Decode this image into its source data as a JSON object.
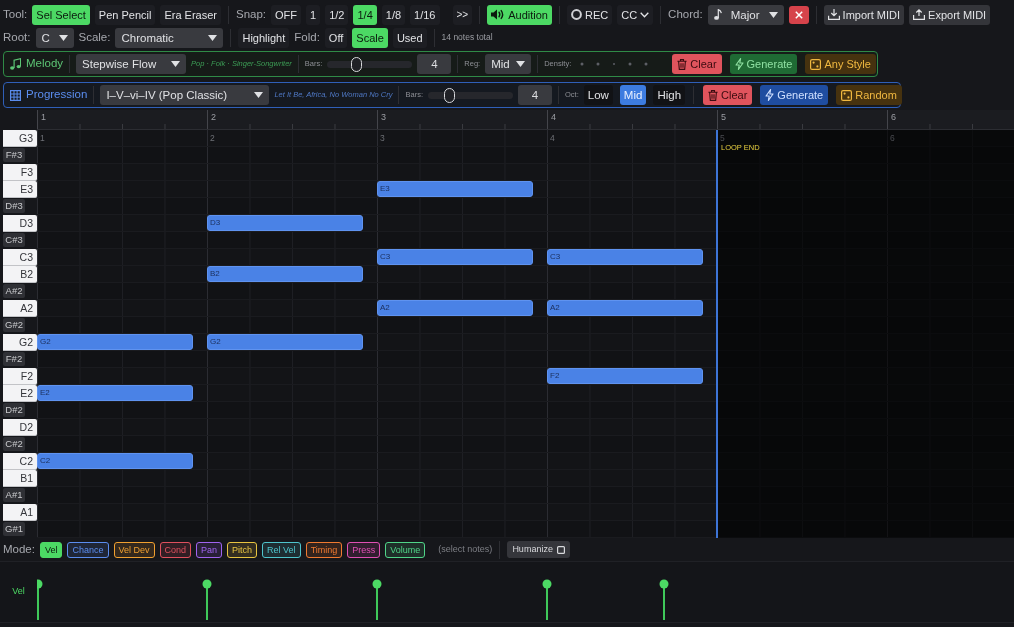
{
  "toolbar": {
    "tool_label": "Tool:",
    "tools": [
      {
        "label": "Sel Select",
        "selected": true
      },
      {
        "label": "Pen Pencil",
        "selected": false
      },
      {
        "label": "Era Eraser",
        "selected": false
      }
    ],
    "snap_label": "Snap:",
    "snaps": [
      {
        "label": "OFF",
        "selected": false
      },
      {
        "label": "1",
        "selected": false
      },
      {
        "label": "1/2",
        "selected": false
      },
      {
        "label": "1/4",
        "selected": true
      },
      {
        "label": "1/8",
        "selected": false
      },
      {
        "label": "1/16",
        "selected": false
      }
    ],
    "more": ">>",
    "audition": {
      "label": "Audition",
      "on": true
    },
    "rec": {
      "label": "REC",
      "on": false
    },
    "cc": "CC",
    "chord_label": "Chord:",
    "chord": "Major",
    "import": "Import MIDI",
    "export": "Export MIDI"
  },
  "toolbar_2": {
    "root_label": "Root:",
    "root": "C",
    "scale_label": "Scale:",
    "scale": "Chromatic",
    "highlight": {
      "label": "Highlight",
      "on": false
    },
    "fold_label": "Fold:",
    "folds": [
      {
        "label": "Off",
        "selected": false
      },
      {
        "label": "Scale",
        "selected": true
      },
      {
        "label": "Used",
        "selected": false
      }
    ],
    "note_count": "14 notes total"
  },
  "melody": {
    "title": "Melody",
    "style": "Stepwise Flow",
    "tags": "Pop · Folk · Singer-Songwriter",
    "bars_label": "Bars:",
    "bars_slider": {
      "level": 0.34
    },
    "bars": "4",
    "register_label": "Reg:",
    "register": "Mid",
    "density_label": "Density:",
    "buttons": [
      {
        "label": "Clear",
        "kind": "clear"
      },
      {
        "label": "Generate",
        "kind": "generate"
      },
      {
        "label": "Any Style",
        "kind": "random"
      }
    ]
  },
  "progression": {
    "title": "Progression",
    "preset": "I–V–vi–IV (Pop Classic)",
    "examples": "Let It Be, Africa, No Woman No Cry",
    "bars_label": "Bars:",
    "bars_slider": {
      "level": 0.25
    },
    "bars": "4",
    "octave_label": "Oct:",
    "octaves": [
      {
        "label": "Low",
        "selected": false
      },
      {
        "label": "Mid",
        "selected": true
      },
      {
        "label": "High",
        "selected": false
      }
    ],
    "buttons": [
      {
        "label": "Clear",
        "kind": "clear"
      },
      {
        "label": "Generate",
        "kind": "generate"
      },
      {
        "label": "Random",
        "kind": "random"
      }
    ]
  },
  "ruler": [
    "1",
    "2",
    "3",
    "4",
    "5",
    "6"
  ],
  "grid_bar_labels": [
    "1",
    "2",
    "3",
    "4",
    "5",
    "6"
  ],
  "loop_end": "LOOP END",
  "rows": [
    {
      "key": "G3",
      "kind": "white"
    },
    {
      "key": "F#3",
      "kind": "black"
    },
    {
      "key": "F3",
      "kind": "white"
    },
    {
      "key": "E3",
      "kind": "white",
      "bars": [
        {
          "note": false
        },
        {
          "note": false
        },
        {
          "note": true,
          "label": "E3"
        },
        {
          "note": false
        }
      ]
    },
    {
      "key": "D#3",
      "kind": "black"
    },
    {
      "key": "D3",
      "kind": "white",
      "bars": [
        {
          "note": false
        },
        {
          "note": true,
          "label": "D3"
        },
        {
          "note": false
        },
        {
          "note": false
        }
      ]
    },
    {
      "key": "C#3",
      "kind": "black"
    },
    {
      "key": "C3",
      "kind": "white",
      "bars": [
        {
          "note": false
        },
        {
          "note": false
        },
        {
          "note": true,
          "label": "C3"
        },
        {
          "note": true,
          "label": "C3"
        }
      ]
    },
    {
      "key": "B2",
      "kind": "white",
      "bars": [
        {
          "note": false
        },
        {
          "note": true,
          "label": "B2"
        },
        {
          "note": false
        },
        {
          "note": false
        }
      ]
    },
    {
      "key": "A#2",
      "kind": "black"
    },
    {
      "key": "A2",
      "kind": "white",
      "bars": [
        {
          "note": false
        },
        {
          "note": false
        },
        {
          "note": true,
          "label": "A2"
        },
        {
          "note": true,
          "label": "A2"
        }
      ]
    },
    {
      "key": "G#2",
      "kind": "black"
    },
    {
      "key": "G2",
      "kind": "white",
      "bars": [
        {
          "note": true,
          "label": "G2"
        },
        {
          "note": true,
          "label": "G2"
        },
        {
          "note": false
        },
        {
          "note": false
        }
      ]
    },
    {
      "key": "F#2",
      "kind": "black"
    },
    {
      "key": "F2",
      "kind": "white",
      "bars": [
        {
          "note": false
        },
        {
          "note": false
        },
        {
          "note": false
        },
        {
          "note": true,
          "label": "F2"
        }
      ]
    },
    {
      "key": "E2",
      "kind": "white",
      "bars": [
        {
          "note": true,
          "label": "E2"
        },
        {
          "note": false
        },
        {
          "note": false
        },
        {
          "note": false
        }
      ]
    },
    {
      "key": "D#2",
      "kind": "black"
    },
    {
      "key": "D2",
      "kind": "white"
    },
    {
      "key": "C#2",
      "kind": "black"
    },
    {
      "key": "C2",
      "kind": "white",
      "bars": [
        {
          "note": true,
          "label": "C2"
        },
        {
          "note": false
        },
        {
          "note": false
        },
        {
          "note": false
        }
      ]
    },
    {
      "key": "B1",
      "kind": "white"
    },
    {
      "key": "A#1",
      "kind": "black"
    },
    {
      "key": "A1",
      "kind": "white"
    },
    {
      "key": "G#1",
      "kind": "black"
    }
  ],
  "lane_mode": {
    "label": "Mode:",
    "modes": [
      {
        "label": "Vel",
        "selected": true,
        "color": "#4cd964"
      },
      {
        "label": "Chance",
        "selected": false,
        "color": "#5b8def"
      },
      {
        "label": "Vel Dev",
        "selected": false,
        "color": "#f0a030"
      },
      {
        "label": "Cond",
        "selected": false,
        "color": "#e0505e"
      },
      {
        "label": "Pan",
        "selected": false,
        "color": "#a064f0"
      },
      {
        "label": "Pitch",
        "selected": false,
        "color": "#e8c440"
      },
      {
        "label": "Rel Vel",
        "selected": false,
        "color": "#4fc4cc"
      },
      {
        "label": "Timing",
        "selected": false,
        "color": "#f07a30"
      },
      {
        "label": "Press",
        "selected": false,
        "color": "#e050b4"
      },
      {
        "label": "Volume",
        "selected": false,
        "color": "#50d488"
      }
    ],
    "hint": "(select notes)",
    "humanize": "Humanize"
  },
  "velocity_lane": {
    "label": "Vel"
  }
}
